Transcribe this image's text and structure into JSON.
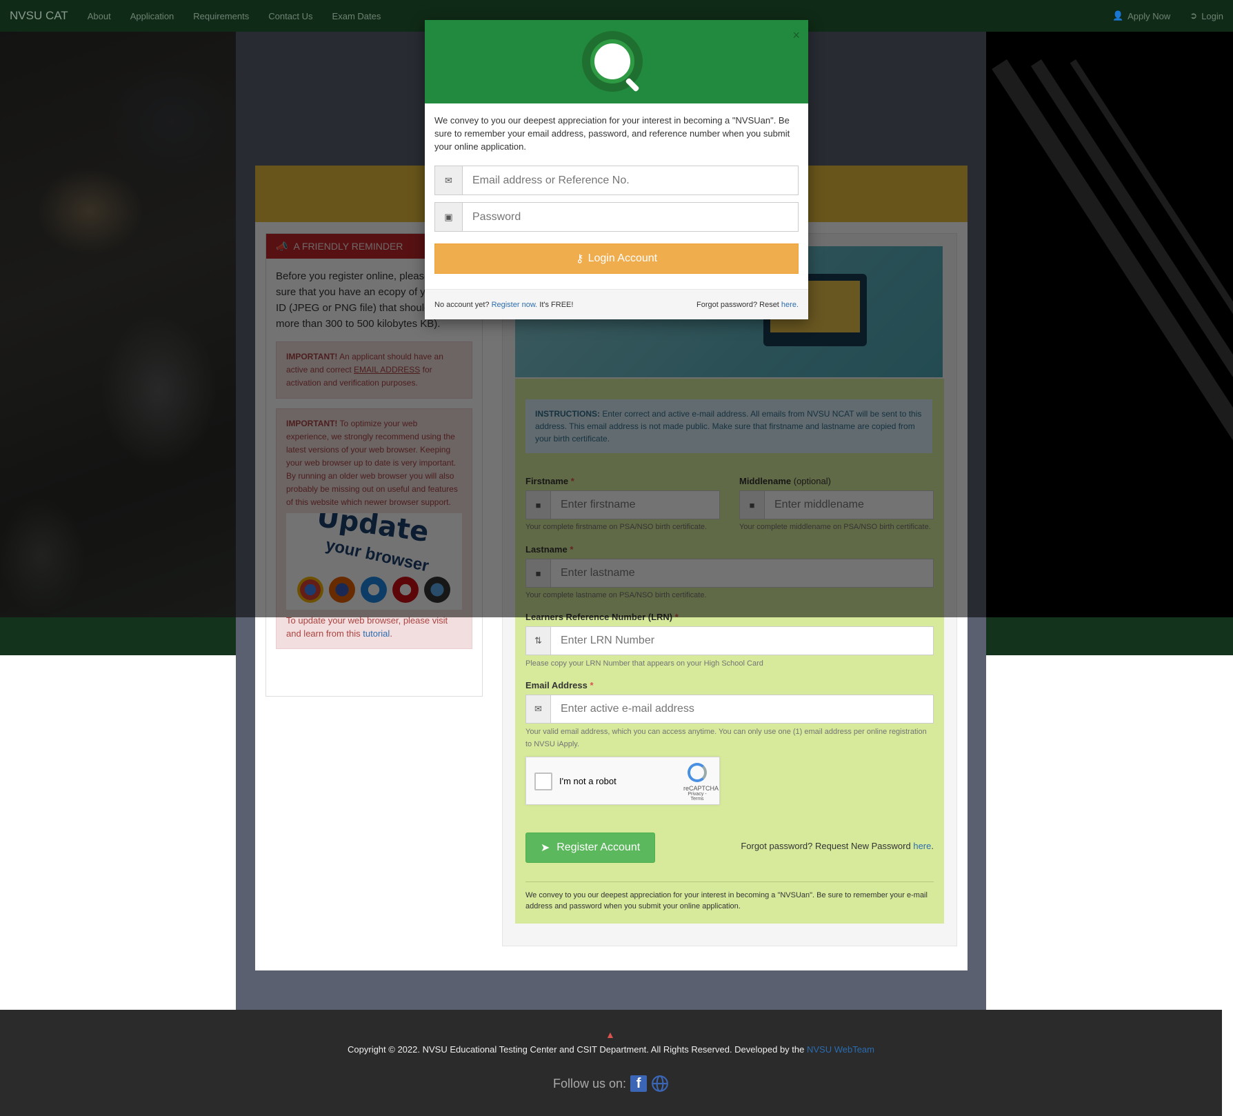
{
  "navbar": {
    "brand": "NVSU CAT",
    "links": [
      "About",
      "Application",
      "Requirements",
      "Contact Us",
      "Exam Dates"
    ],
    "apply_now": "Apply Now",
    "login": "Login"
  },
  "reminder": {
    "header": "A FRIENDLY REMINDER",
    "body": "Before you register online, please make sure that you have an ecopy of your Photo ID (JPEG or PNG file) that should not be more than 300 to 500 kilobytes KB).",
    "alert1_strong": "IMPORTANT!",
    "alert1_text_a": " An applicant should have an active and correct ",
    "alert1_underline": "EMAIL ADDRESS",
    "alert1_text_b": " for activation and verification purposes.",
    "alert2_strong": "IMPORTANT!",
    "alert2_text": " To optimize your web experience, we strongly recommend using the latest versions of your web browser. Keeping your web browser up to date is very important. By running an older web browser you will also probably be missing out on useful and features of this website which newer browser support.",
    "update_image_text": "Update",
    "update_image_sub": "your browser",
    "update_tutorial_a": "To update your web browser, please visit and learn from this ",
    "update_tutorial_link": "tutorial",
    "update_tutorial_b": "."
  },
  "registration": {
    "instructions_strong": "INSTRUCTIONS:",
    "instructions": " Enter correct and active e-mail address. All emails from NVSU NCAT will be sent to this address. This email address is not made public. Make sure that firstname and lastname are copied from your birth certificate.",
    "firstname_label": "Firstname",
    "firstname_placeholder": "Enter firstname",
    "firstname_help": "Your complete firstname on PSA/NSO birth certificate.",
    "middlename_label": "Middlename",
    "middlename_optional": "(optional)",
    "middlename_placeholder": "Enter middlename",
    "middlename_help": "Your complete middlename on PSA/NSO birth certificate.",
    "lastname_label": "Lastname",
    "lastname_placeholder": "Enter lastname",
    "lastname_help": "Your complete lastname on PSA/NSO birth certificate.",
    "lrn_label": "Learners Reference Number (LRN)",
    "lrn_placeholder": "Enter LRN Number",
    "lrn_help": "Please copy your LRN Number that appears on your High School Card",
    "email_label": "Email Address",
    "email_placeholder": "Enter active e-mail address",
    "email_help": "Your valid email address, which you can access anytime. You can only use one (1) email address per online registration to NVSU iApply.",
    "required_mark": "*",
    "captcha_label": "I'm not a robot",
    "captcha_brand": "reCAPTCHA",
    "captcha_terms": "Privacy - Terms",
    "register_button": "Register Account",
    "forgot_text": "Forgot password? Request New Password ",
    "forgot_link": "here",
    "forgot_end": ".",
    "footnote": "We convey to you our deepest appreciation for your interest in becoming a \"NVSUan\". Be sure to remember your e-mail address and password when you submit your online application."
  },
  "modal": {
    "close": "×",
    "intro": "We convey to you our deepest appreciation for your interest in becoming a \"NVSUan\". Be sure to remember your email address, password, and reference number when you submit your online application.",
    "email_placeholder": "Email address or Reference No.",
    "password_placeholder": "Password",
    "login_button": "Login Account",
    "no_account": "No account yet? ",
    "register_link": "Register now.",
    "free_text": " It's FREE!",
    "forgot": "Forgot password? Reset ",
    "forgot_link": "here."
  },
  "footer": {
    "copyright": "Copyright © 2022. NVSU Educational Testing Center and CSIT Department. All Rights Reserved. Developed by the ",
    "webteam_link": "NVSU WebTeam",
    "follow": "Follow us on:"
  },
  "colors": {
    "modal_header": "#218a3e",
    "login_button": "#f0ad4e",
    "register_button": "#5cb85c",
    "reminder_header": "#c0262b",
    "navbar": "#0f2a16"
  }
}
